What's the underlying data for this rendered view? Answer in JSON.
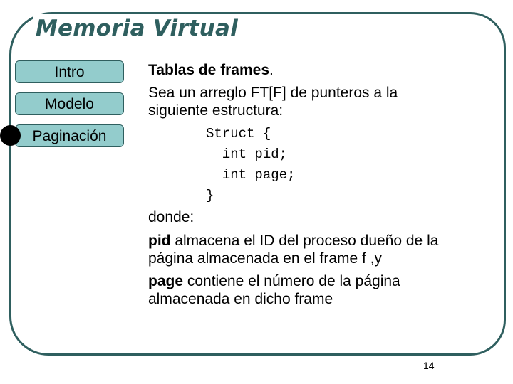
{
  "slide": {
    "title": "Memoria Virtual",
    "page_number": "14",
    "colors": {
      "accent": "#2f5f5f",
      "nav_fill": "#93cccc",
      "active_marker": "#000000"
    }
  },
  "nav": {
    "items": [
      {
        "label": "Intro"
      },
      {
        "label": "Modelo"
      },
      {
        "label": "Paginación",
        "active": true
      }
    ]
  },
  "content": {
    "heading_bold": "Tablas de frames",
    "heading_suffix": ".",
    "intro_line1": "Sea un arreglo FT[F] de punteros a la",
    "intro_line2": "siguiente estructura:",
    "code_lines": [
      "Struct {",
      "  int pid;",
      "  int page;",
      "}"
    ],
    "donde": "donde:",
    "pid_term": "pid",
    "pid_desc_line1": " almacena el ID del proceso dueño de la",
    "pid_desc_line2": "página almacenada en el frame f ,y",
    "page_term": "page",
    "page_desc_line1": " contiene el número de la página",
    "page_desc_line2": "almacenada en dicho frame"
  }
}
